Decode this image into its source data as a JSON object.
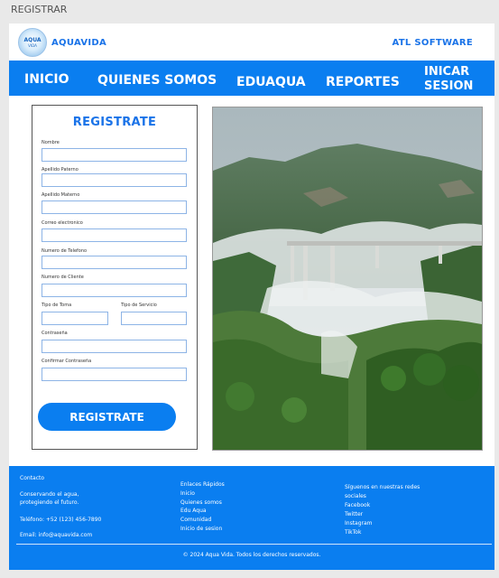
{
  "window": {
    "title": "REGISTRAR"
  },
  "header": {
    "logo_text": "AQUA",
    "logo_subtext": "VIDA",
    "brand": "AQUAVIDA",
    "company": "ATL SOFTWARE"
  },
  "nav": {
    "inicio": "INICIO",
    "quienes": "QUIENES SOMOS",
    "eduaqua": "EDUAQUA",
    "reportes": "REPORTES",
    "iniciar": "INICAR SESION"
  },
  "form": {
    "title": "REGISTRATE",
    "fields": {
      "nombre": "Nombre",
      "apellido_paterno": "Apellido Paterno",
      "apellido_materno": "Apellido Materno",
      "correo": "Correo electronico",
      "telefono": "Numero de Telefono",
      "cliente": "Numero de Cliente",
      "tipo_toma": "Tipo de Toma",
      "tipo_servicio": "Tipo de Servicio",
      "contrasena": "Contraseña",
      "confirmar": "Confirmar Contraseña"
    },
    "values": {
      "nombre": "",
      "apellido_paterno": "",
      "apellido_materno": "",
      "correo": "",
      "telefono": "",
      "cliente": "",
      "tipo_toma": "",
      "tipo_servicio": "",
      "contrasena": "",
      "confirmar": ""
    },
    "submit": "REGISTRATE"
  },
  "footer": {
    "contacto_title": "Contacto",
    "slogan_line1": "Conservando el agua,",
    "slogan_line2": "protegiendo el futuro.",
    "telefono": "Teléfono: +52 (123) 456-7890",
    "email": "Email: info@aquavida.com",
    "links_title": "Enlaces Rápidos",
    "links": [
      "Inicio",
      "Quienes somos",
      "Edu Aqua",
      "Comunidad",
      "Inicio de sesion"
    ],
    "social_title_line1": "Síguenos en nuestras redes",
    "social_title_line2": "sociales",
    "social": [
      "Facebook",
      "Twitter",
      "Instagram",
      "TikTok"
    ],
    "copyright": "© 2024 Aqua Vida. Todos los derechos reservados."
  },
  "colors": {
    "primary": "#0a7ef0",
    "accent_text": "#1a73e8",
    "input_border": "#8db4e6"
  }
}
